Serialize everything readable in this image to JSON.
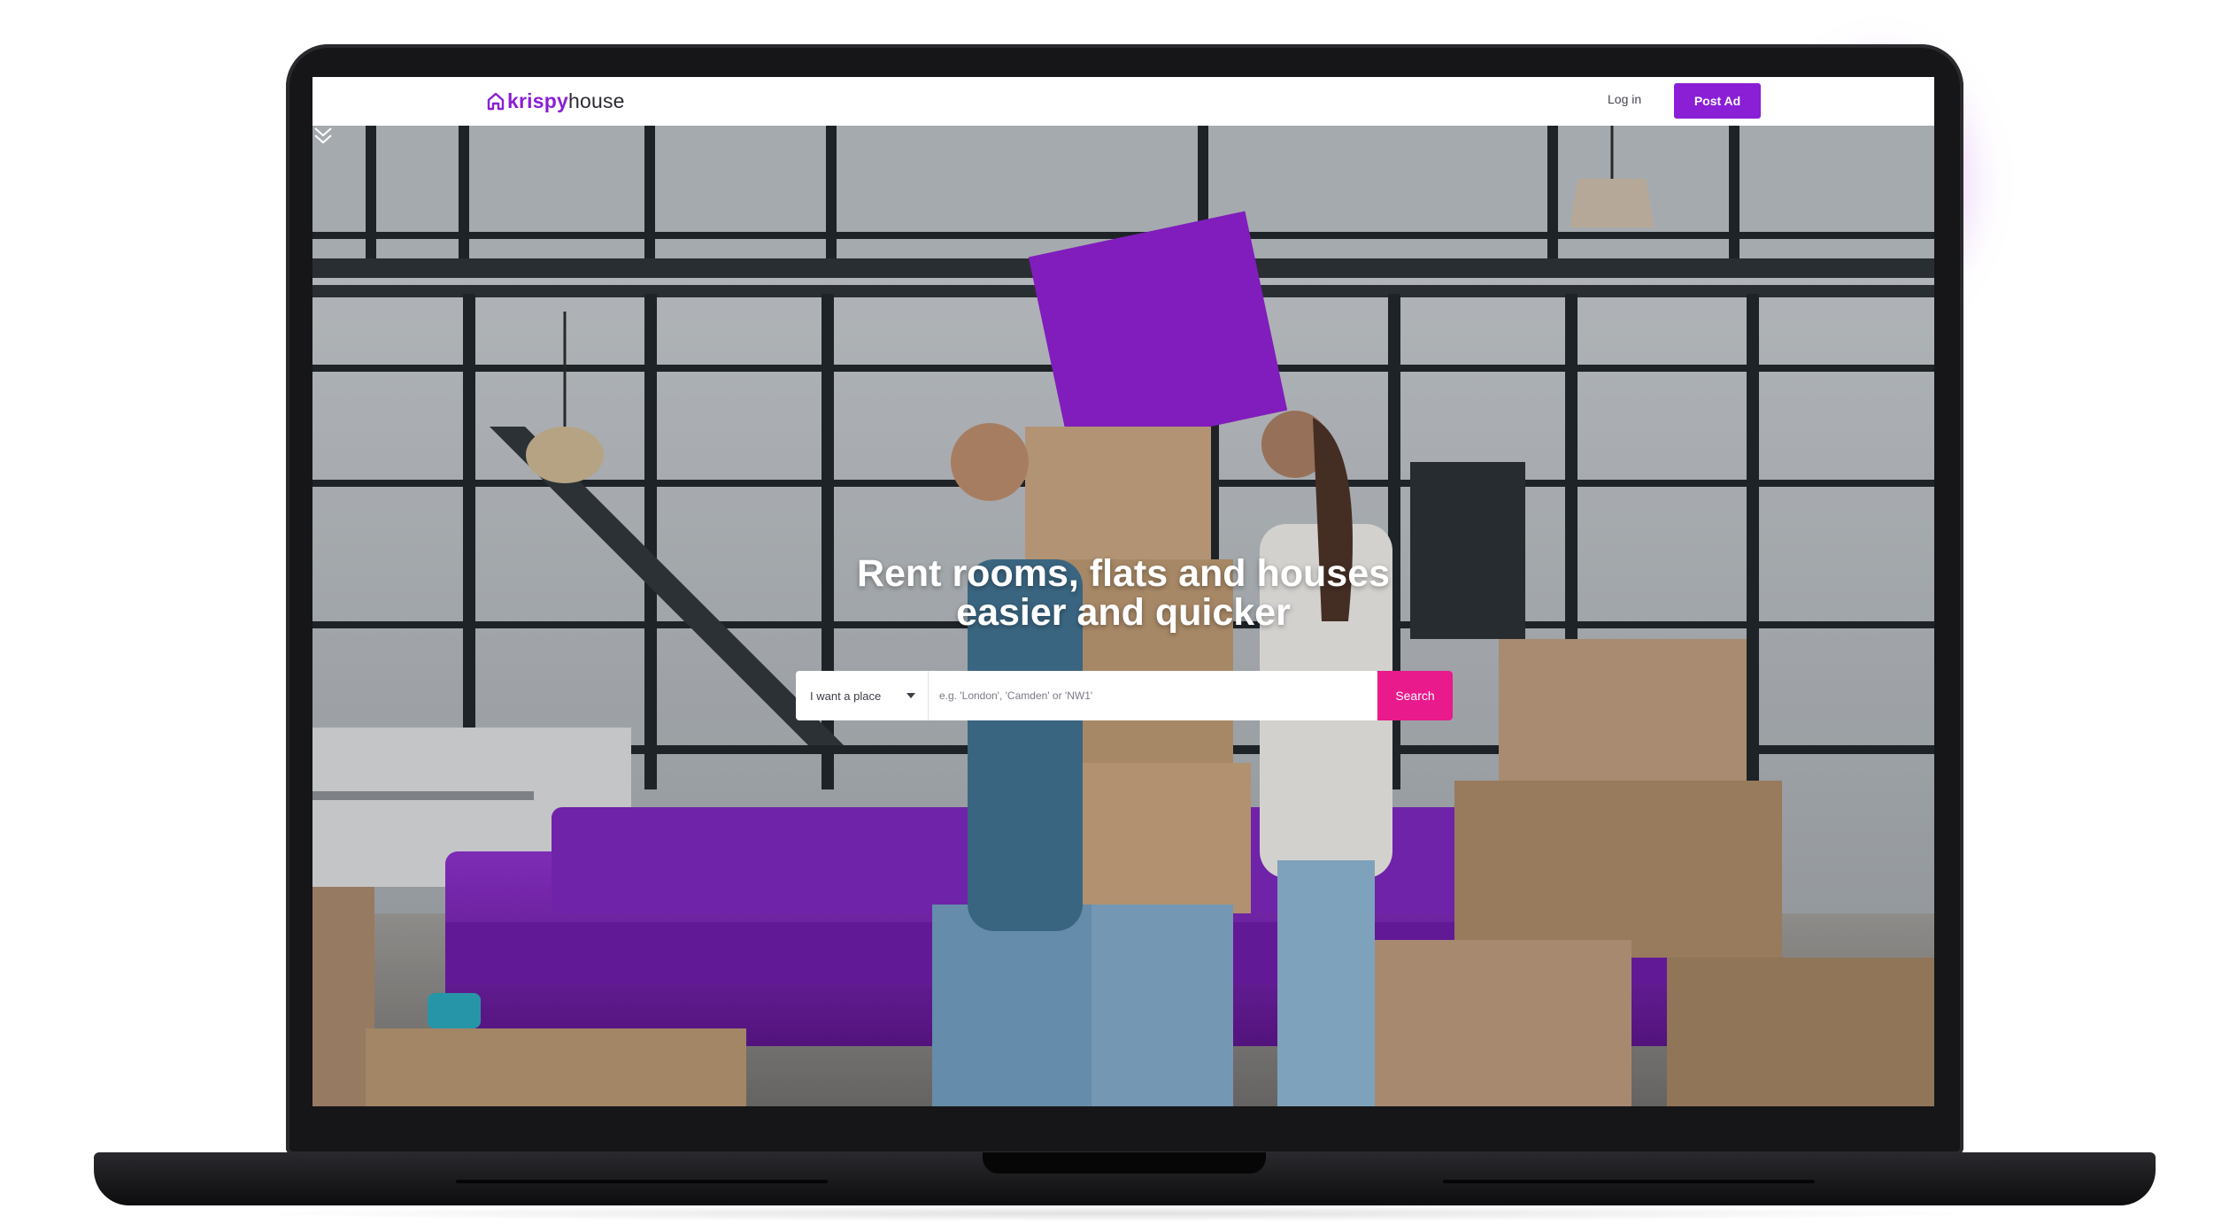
{
  "app": {
    "logo_part1": "krispy",
    "logo_part2": "house",
    "brand_color": "#8a1fd6",
    "accent_color": "#e81a8c"
  },
  "nav": {
    "login_label": "Log in",
    "post_ad_label": "Post Ad"
  },
  "hero": {
    "headline_line1": "Rent rooms, flats and houses",
    "headline_line2": "easier and quicker",
    "background_image": "couple-moving-boxes-purple-sofa"
  },
  "search": {
    "type_select_value": "I want a place",
    "query_placeholder": "e.g. 'London', 'Camden' or 'NW1'",
    "query_value": "",
    "button_label": "Search"
  },
  "icons": {
    "logo": "house-outline-icon",
    "select": "caret-down-icon",
    "scroll": "double-chevron-down-icon"
  }
}
